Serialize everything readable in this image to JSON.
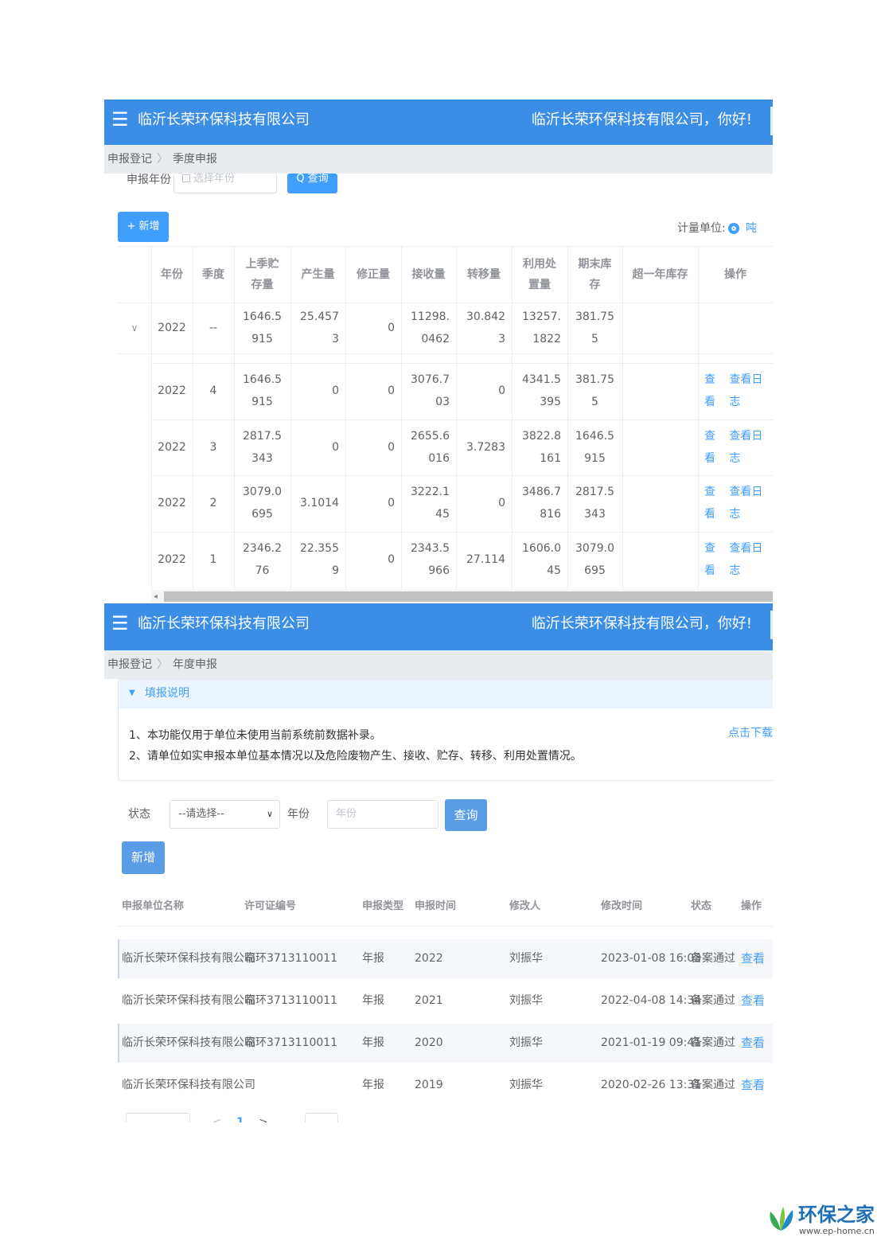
{
  "quarterly": {
    "header": {
      "menu_icon": "☰",
      "company": "临沂长荣环保科技有限公司",
      "greeting": "临沂长荣环保科技有限公司，你好!"
    },
    "breadcrumb": {
      "root": "申报登记",
      "current": "季度申报"
    },
    "filter": {
      "year_label": "申报年份",
      "year_placeholder": "选择年份",
      "query_label": "Q 查询"
    },
    "add_label": "+ 新增",
    "unit_label": "计量单位:",
    "unit_value": "吨",
    "columns": [
      "年份",
      "季度",
      "上季贮存量",
      "产生量",
      "修正量",
      "接收量",
      "转移量",
      "利用处置量",
      "期末库存",
      "超一年库存",
      "操作"
    ],
    "summary": {
      "year": "2022",
      "quarter": "--",
      "prev_storage": "1646.5915",
      "produced": "25.4573",
      "corrected": "0",
      "received": "11298.0462",
      "transferred": "30.8423",
      "disposed": "13257.1822",
      "end_stock": "381.755",
      "over_year": ""
    },
    "rows": [
      {
        "year": "2022",
        "quarter": "4",
        "prev_storage": "1646.5915",
        "produced": "0",
        "corrected": "0",
        "received": "3076.703",
        "transferred": "0",
        "disposed": "4341.5395",
        "end_stock": "381.755",
        "over_year": "",
        "view": "查看",
        "log": "查看日志"
      },
      {
        "year": "2022",
        "quarter": "3",
        "prev_storage": "2817.5343",
        "produced": "0",
        "corrected": "0",
        "received": "2655.6016",
        "transferred": "3.7283",
        "disposed": "3822.8161",
        "end_stock": "1646.5915",
        "over_year": "",
        "view": "查看",
        "log": "查看日志"
      },
      {
        "year": "2022",
        "quarter": "2",
        "prev_storage": "3079.0695",
        "produced": "3.1014",
        "corrected": "0",
        "received": "3222.145",
        "transferred": "0",
        "disposed": "3486.7816",
        "end_stock": "2817.5343",
        "over_year": "",
        "view": "查看",
        "log": "查看日志"
      },
      {
        "year": "2022",
        "quarter": "1",
        "prev_storage": "2346.276",
        "produced": "22.3559",
        "corrected": "0",
        "received": "2343.5966",
        "transferred": "27.114",
        "disposed": "1606.045",
        "end_stock": "3079.0695",
        "over_year": "",
        "view": "查看",
        "log": "查看日志"
      }
    ]
  },
  "annual": {
    "header": {
      "menu_icon": "☰",
      "company": "临沂长荣环保科技有限公司",
      "greeting": "临沂长荣环保科技有限公司，你好!"
    },
    "breadcrumb": {
      "root": "申报登记",
      "current": "年度申报"
    },
    "notice": {
      "title": "填报说明",
      "lines": [
        "1、本功能仅用于单位未使用当前系统前数据补录。",
        "2、请单位如实申报本单位基本情况以及危险废物产生、接收、贮存、转移、利用处置情况。"
      ],
      "download": "点击下载"
    },
    "filter": {
      "status_label": "状态",
      "status_value": "--请选择--",
      "year_label": "年份",
      "year_placeholder": "年份",
      "query_label": "查询"
    },
    "add_label": "新增",
    "columns": [
      "申报单位名称",
      "许可证编号",
      "申报类型",
      "申报时间",
      "修改人",
      "修改时间",
      "状态",
      "操作"
    ],
    "rows": [
      {
        "unit": "临沂长荣环保科技有限公司",
        "license": "临环3713110011",
        "type": "年报",
        "year": "2022",
        "modifier": "刘振华",
        "time": "2023-01-08 16:03",
        "status": "备案通过",
        "action": "查看"
      },
      {
        "unit": "临沂长荣环保科技有限公司",
        "license": "临环3713110011",
        "type": "年报",
        "year": "2021",
        "modifier": "刘振华",
        "time": "2022-04-08 14:34",
        "status": "备案通过",
        "action": "查看"
      },
      {
        "unit": "临沂长荣环保科技有限公司",
        "license": "临环3713110011",
        "type": "年报",
        "year": "2020",
        "modifier": "刘振华",
        "time": "2021-01-19 09:41",
        "status": "备案通过",
        "action": "查看"
      },
      {
        "unit": "临沂长荣环保科技有限公司",
        "license": "",
        "type": "年报",
        "year": "2019",
        "modifier": "刘振华",
        "time": "2020-02-26 13:31",
        "status": "备案通过",
        "action": "查看"
      }
    ]
  },
  "watermark": {
    "name": "环保之家",
    "url": "www.ep-home.cn"
  }
}
